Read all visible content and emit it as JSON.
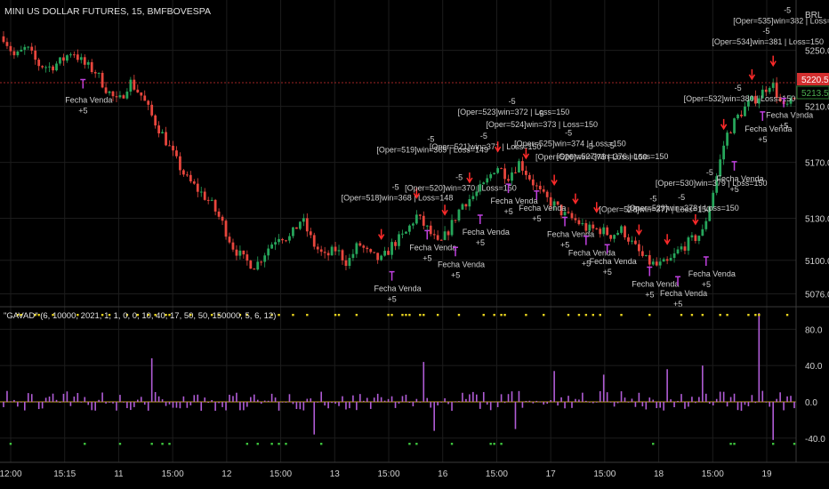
{
  "header": {
    "symbol_title": "MINI US DOLLAR FUTURES, 15, BMFBOVESPA",
    "currency": "BRL",
    "indicator_title": "\"GAVAD\" (6, 10000, 2021, 1, 1, 0, 0, 10, 40, 17, 50, 50, 150000, 5, 6, 12)"
  },
  "colors": {
    "background": "#000000",
    "up_candle": "#26a65b",
    "down_candle": "#e8463d",
    "wick": "#cfcfcf",
    "histogram": "#b05cd6",
    "marker_yellow": "#e7d21e",
    "marker_green": "#3ec43e",
    "signal_arrow": "#ff2a2a",
    "exit_arrow": "#c040e0",
    "zero_line": "#c9a227",
    "grid": "#1c1c1c",
    "text": "#d0d0d0",
    "price_tag_red": "#d32f2f",
    "price_tag_green": "#2e7d32"
  },
  "price_tags": {
    "red": "5220.5",
    "green": "5213.5"
  },
  "chart_data": [
    {
      "type": "candlestick",
      "title": "MINI US DOLLAR FUTURES, 15, BMFBOVESPA",
      "currency": "BRL",
      "x_tick_labels": [
        "12:00",
        "15:15",
        "11",
        "15:00",
        "12",
        "15:00",
        "13",
        "15:00",
        "16",
        "15:00",
        "17",
        "15:00",
        "18",
        "15:00",
        "19"
      ],
      "y_ticks": [
        5250.0,
        5210.0,
        5170.0,
        5130.0,
        5100.0,
        5076.0
      ],
      "ylim": [
        5070,
        5272
      ],
      "close_path": [
        5260,
        5245,
        5252,
        5240,
        5238,
        5242,
        5250,
        5240,
        5235,
        5222,
        5212,
        5228,
        5218,
        5202,
        5188,
        5172,
        5158,
        5150,
        5142,
        5128,
        5110,
        5100,
        5096,
        5108,
        5118,
        5116,
        5130,
        5112,
        5102,
        5108,
        5098,
        5112,
        5103,
        5100,
        5112,
        5118,
        5132,
        5122,
        5110,
        5124,
        5140,
        5146,
        5154,
        5168,
        5160,
        5170,
        5158,
        5146,
        5140,
        5132,
        5128,
        5122,
        5122,
        5118,
        5122,
        5110,
        5100,
        5096,
        5098,
        5108,
        5114,
        5120,
        5152,
        5188,
        5202,
        5212,
        5218,
        5228,
        5208,
        5214
      ],
      "annotations_trade": [
        "[Oper=518]win=368 | Loss=148",
        "[Oper=519]win=369 | Loss=149",
        "[Oper=520]win=370 | Loss=150",
        "[Oper=521]win=371 | Loss=150",
        "[Oper=523]win=372 | Loss=150",
        "[Oper=524]win=373 | Loss=150",
        "[Oper=525]win=374 | Loss=150",
        "[Oper=526]win=375 | Loss=150",
        "[Oper=527]win=376 | Loss=150",
        "[Oper=528]win=377 | Loss=150",
        "[Oper=529]win=378 | Loss=150",
        "[Oper=530]win=379 | Loss=150",
        "[Oper=532]win=380 | Loss=150",
        "[Oper=534]win=381 | Loss=150",
        "[Oper=535]win=382 | Loss=150"
      ],
      "annotation_exit": "Fecha Venda",
      "annotation_plus": "+5",
      "annotation_minus": "-5"
    },
    {
      "type": "bar",
      "title": "\"GAVAD\" (6, 10000, 2021, 1, 1, 0, 0, 10, 40, 17, 50, 50, 150000, 5, 6, 12)",
      "y_ticks": [
        80.0,
        40.0,
        0.0,
        -40.0
      ],
      "ylim": [
        -52,
        100
      ],
      "spikes": [
        {
          "i": 42,
          "v": 48
        },
        {
          "i": 88,
          "v": -36
        },
        {
          "i": 119,
          "v": 44
        },
        {
          "i": 122,
          "v": -32
        },
        {
          "i": 145,
          "v": -30
        },
        {
          "i": 156,
          "v": 34
        },
        {
          "i": 170,
          "v": 30
        },
        {
          "i": 188,
          "v": 36
        },
        {
          "i": 198,
          "v": 40
        },
        {
          "i": 214,
          "v": 98
        },
        {
          "i": 218,
          "v": -42
        }
      ]
    }
  ]
}
